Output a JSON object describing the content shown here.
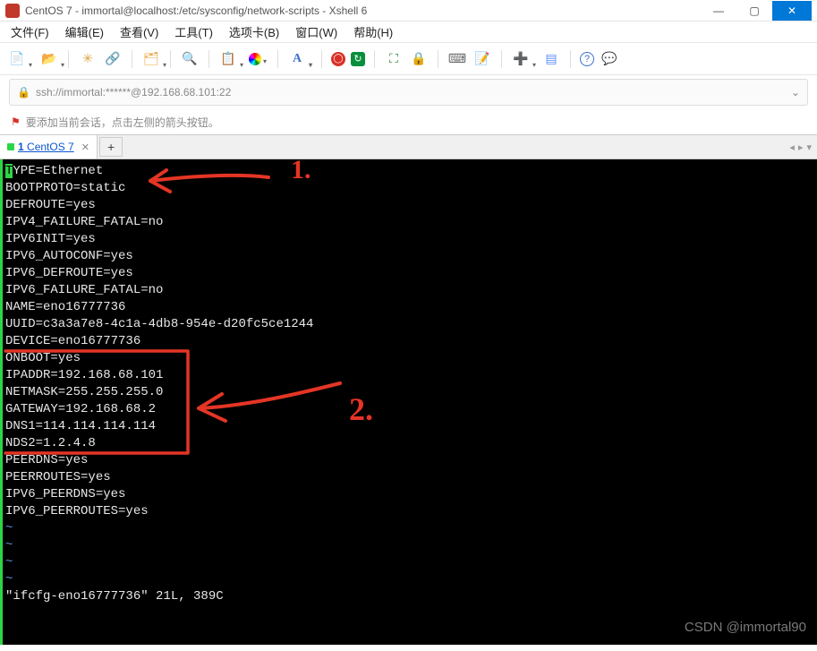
{
  "window": {
    "title": "CentOS 7 - immortal@localhost:/etc/sysconfig/network-scripts - Xshell 6"
  },
  "menu": {
    "file": "文件(F)",
    "edit": "编辑(E)",
    "view": "查看(V)",
    "tools": "工具(T)",
    "tabs": "选项卡(B)",
    "window": "窗口(W)",
    "help": "帮助(H)"
  },
  "toolbar_icons": {
    "new": "📄",
    "open": "📂",
    "props": "✳",
    "link": "🔗",
    "disconnect": "🗂",
    "find": "🔍",
    "copy": "📋",
    "paste": "▦",
    "font": "A",
    "font2": "A",
    "bold": "◯",
    "refresh": "↻",
    "fullscreen": "⛶",
    "lock": "🔒",
    "keyboard": "⌨",
    "compose": "📝",
    "newwin": "➕",
    "tile": "▤",
    "help": "?",
    "speech": "💬"
  },
  "address": {
    "url": "ssh://immortal:******@192.168.68.101:22"
  },
  "hint": {
    "text": "要添加当前会话，点击左侧的箭头按钮。"
  },
  "tabs": {
    "active": {
      "index": "1",
      "label": "CentOS 7"
    },
    "add": "+"
  },
  "terminal": {
    "first_char": "T",
    "lines": [
      "YPE=Ethernet",
      "BOOTPROTO=static",
      "DEFROUTE=yes",
      "IPV4_FAILURE_FATAL=no",
      "IPV6INIT=yes",
      "IPV6_AUTOCONF=yes",
      "IPV6_DEFROUTE=yes",
      "IPV6_FAILURE_FATAL=no",
      "NAME=eno16777736",
      "UUID=c3a3a7e8-4c1a-4db8-954e-d20fc5ce1244",
      "DEVICE=eno16777736",
      "ONBOOT=yes",
      "IPADDR=192.168.68.101",
      "NETMASK=255.255.255.0",
      "GATEWAY=192.168.68.2",
      "DNS1=114.114.114.114",
      "NDS2=1.2.4.8",
      "PEERDNS=yes",
      "PEERROUTES=yes",
      "IPV6_PEERDNS=yes",
      "IPV6_PEERROUTES=yes"
    ],
    "tildes": [
      "~",
      "~",
      "~",
      "~"
    ],
    "status": "\"ifcfg-eno16777736\" 21L, 389C"
  },
  "annotations": {
    "label1": "1.",
    "label2": "2."
  },
  "watermark": "CSDN @immortal90"
}
